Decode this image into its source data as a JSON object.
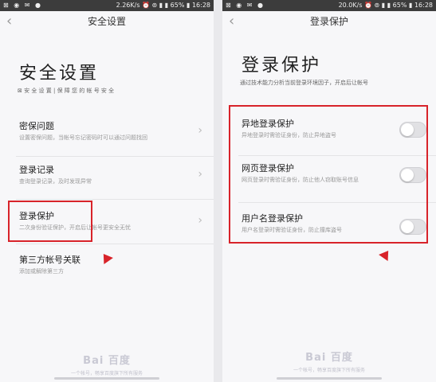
{
  "left": {
    "status": {
      "left_icons": "⊠ ◉ ✉ ●",
      "right": "2.26K/s ⏰ ⊚ ▮ ▮ 65% ▮ 16:28"
    },
    "nav": {
      "back": "‹",
      "title": "安全设置"
    },
    "title": "安全设置",
    "subtitle": "⊠ 安 全 设 置 | 保 障 您 的 帐 号 安 全",
    "items": [
      {
        "title": "密保问题",
        "desc": "设置密保问题，当帐号忘记密码时可以通过问题找回",
        "arrow": "›"
      },
      {
        "title": "登录记录",
        "desc": "查询登录记录，及时发现异常",
        "arrow": "›"
      },
      {
        "title": "登录保护",
        "desc": "二次身份验证保护，开启后让帐号更安全无忧",
        "arrow": "›"
      },
      {
        "title": "第三方帐号关联",
        "desc": "添加或解除第三方",
        "arrow": ""
      }
    ],
    "watermark": {
      "logo": "Bai 百度",
      "text": "一个帐号，畅享百度旗下所有服务"
    },
    "highlight_color": "#d8232a"
  },
  "right": {
    "status": {
      "left_icons": "⊠ ◉ ✉ ●",
      "right": "20.0K/s ⏰ ⊚ ▮ ▮ 65% ▮ 16:28"
    },
    "nav": {
      "back": "‹",
      "title": "登录保护"
    },
    "title": "登录保护",
    "subtitle": "通过技术能力分析当前登录环境因子，开启后让帐号",
    "items": [
      {
        "title": "异地登录保护",
        "desc": "异地登录时需验证身份，防止异地盗号",
        "enabled": false
      },
      {
        "title": "网页登录保护",
        "desc": "网页登录时需验证身份，防止他人窃取账号信息",
        "enabled": false
      },
      {
        "title": "用户名登录保护",
        "desc": "用户名登录时需验证身份，防止撞库盗号",
        "enabled": false
      }
    ],
    "watermark": {
      "logo": "Bai 百度",
      "text": "一个帐号，畅享百度旗下所有服务"
    },
    "highlight_color": "#d8232a"
  }
}
